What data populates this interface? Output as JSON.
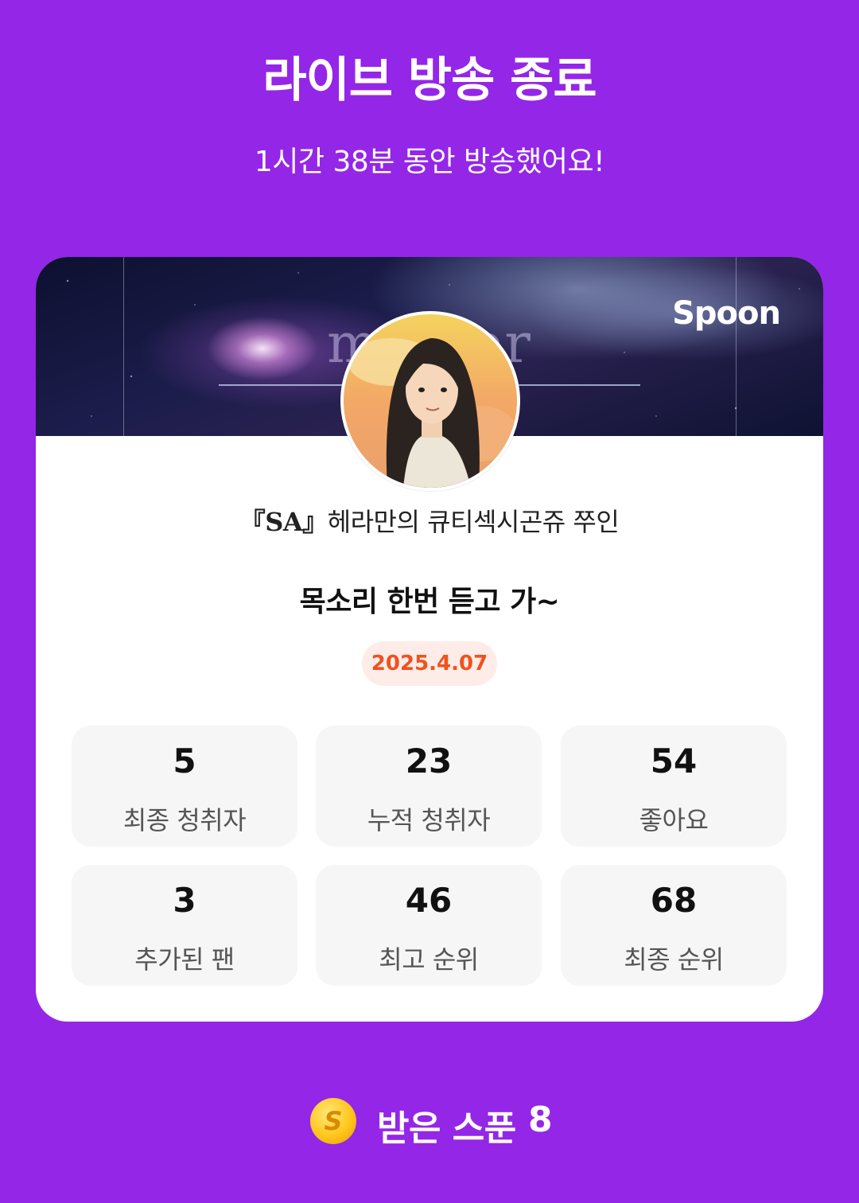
{
  "header": {
    "title": "라이브 방송 종료",
    "subtitle": "1시간 38분 동안 방송했어요!"
  },
  "card": {
    "banner": {
      "logo_text": "Spoon",
      "decor_text": "meteor"
    },
    "avatar": {
      "icon": "profile-avatar"
    },
    "username_tag": "『SA』",
    "username_rest": "헤라만의 큐티섹시곤쥬 쭈인",
    "live_title": "목소리 한번 듣고 가~",
    "date": "2025.4.07"
  },
  "stats": [
    {
      "value": "5",
      "label": "최종 청취자"
    },
    {
      "value": "23",
      "label": "누적 청취자"
    },
    {
      "value": "54",
      "label": "좋아요"
    },
    {
      "value": "3",
      "label": "추가된 팬"
    },
    {
      "value": "46",
      "label": "최고 순위"
    },
    {
      "value": "68",
      "label": "최종 순위"
    }
  ],
  "spoons": {
    "coin_glyph": "S",
    "label": "받은 스푼",
    "count": "8"
  },
  "colors": {
    "background": "#9426e8",
    "date_text": "#f0521d",
    "date_bg": "#fdece8"
  }
}
